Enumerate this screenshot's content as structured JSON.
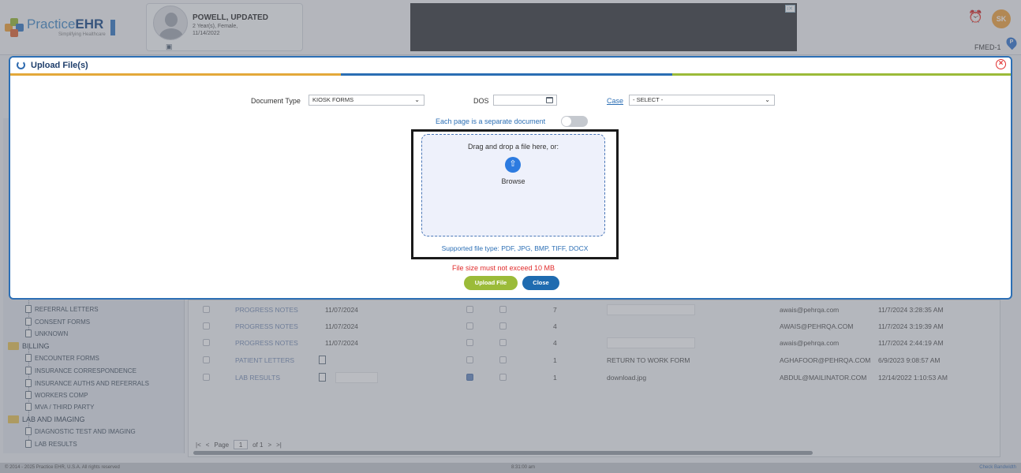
{
  "header": {
    "logo_text_light": "Practice",
    "logo_text_bold": "EHR",
    "logo_tagline": "Simplifying Healthcare",
    "patient": {
      "name": "POWELL, UPDATED",
      "age_sex": "2 Year(s), Female,",
      "dob": "11/14/2022"
    },
    "user_initials": "SK",
    "facility": "FMED-1",
    "pin_label": "P"
  },
  "modal": {
    "title": "Upload File(s)",
    "document_type_label": "Document Type",
    "document_type_value": "KIOSK FORMS",
    "dos_label": "DOS",
    "dos_value": "",
    "case_label": "Case",
    "case_value": "- SELECT -",
    "separate_doc_label": "Each page is a separate document",
    "drop_text": "Drag and drop a file here, or:",
    "browse_label": "Browse",
    "supported_types": "Supported file type: PDF, JPG, BMP, TIFF, DOCX",
    "size_warning": "File size must not exceed 10 MB",
    "upload_button": "Upload File",
    "close_button": "Close",
    "stripe_colors": [
      "#e3a83a",
      "#2a6eb3",
      "#9bbb39"
    ]
  },
  "sidebar": {
    "items": [
      {
        "label": "REFERRAL LETTERS",
        "type": "doc"
      },
      {
        "label": "CONSENT FORMS",
        "type": "doc"
      },
      {
        "label": "UNKNOWN",
        "type": "doc"
      },
      {
        "label": "BILLING",
        "type": "folder"
      },
      {
        "label": "ENCOUNTER FORMS",
        "type": "doc"
      },
      {
        "label": "INSURANCE CORRESPONDENCE",
        "type": "doc"
      },
      {
        "label": "INSURANCE AUTHS AND REFERRALS",
        "type": "doc"
      },
      {
        "label": "WORKERS COMP",
        "type": "doc"
      },
      {
        "label": "MVA / THIRD PARTY",
        "type": "doc"
      },
      {
        "label": "LAB AND IMAGING",
        "type": "folder"
      },
      {
        "label": "DIAGNOSTIC TEST AND IMAGING",
        "type": "doc"
      },
      {
        "label": "LAB RESULTS",
        "type": "doc"
      }
    ]
  },
  "grid": {
    "rows": [
      {
        "type": "PROGRESS NOTES",
        "date": "11/07/2024",
        "pages": "7",
        "desc": "",
        "user": "awais@pehrqa.com",
        "uploaded": "11/7/2024 3:28:35 AM",
        "checked": false,
        "icon": false
      },
      {
        "type": "PROGRESS NOTES",
        "date": "11/07/2024",
        "pages": "4",
        "desc": "",
        "user": "AWAIS@PEHRQA.COM",
        "uploaded": "11/7/2024 3:19:39 AM",
        "checked": false,
        "icon": false
      },
      {
        "type": "PROGRESS NOTES",
        "date": "11/07/2024",
        "pages": "4",
        "desc": "",
        "user": "awais@pehrqa.com",
        "uploaded": "11/7/2024 2:44:19 AM",
        "checked": false,
        "icon": false
      },
      {
        "type": "PATIENT LETTERS",
        "date": "",
        "pages": "1",
        "desc": "RETURN TO WORK FORM",
        "user": "AGHAFOOR@PEHRQA.COM",
        "uploaded": "6/9/2023 9:08:57 AM",
        "checked": false,
        "icon": true
      },
      {
        "type": "LAB RESULTS",
        "date": "",
        "pages": "1",
        "desc": "download.jpg",
        "user": "ABDUL@MAILINATOR.COM",
        "uploaded": "12/14/2022 1:10:53 AM",
        "checked": true,
        "icon": true
      }
    ],
    "pager": {
      "page_label": "Page",
      "page": "1",
      "of_label": "of 1"
    }
  },
  "footer": {
    "copyright": "© 2014 - 2025 Practice EHR, U.S.A. All rights reserved",
    "time": "8:31:00 am",
    "bandwidth": "Check Bandwidth"
  }
}
